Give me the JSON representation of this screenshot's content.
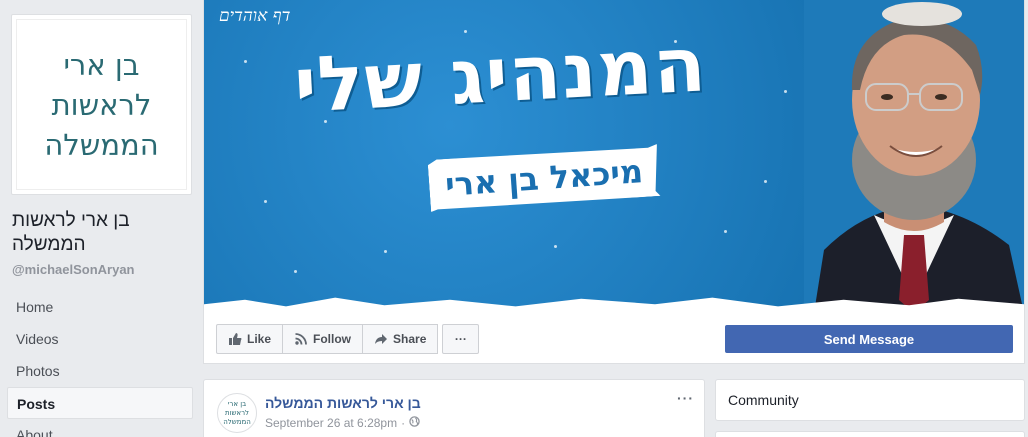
{
  "page": {
    "avatar_text_line1": "בן ארי",
    "avatar_text_line2": "לראשות",
    "avatar_text_line3": "הממשלה",
    "name": "בן ארי לראשות הממשלה",
    "handle": "@michaelSonAryan"
  },
  "sidebar": {
    "items": [
      {
        "label": "Home"
      },
      {
        "label": "Videos"
      },
      {
        "label": "Photos"
      },
      {
        "label": "Posts"
      },
      {
        "label": "About"
      }
    ],
    "active": "Posts"
  },
  "cover": {
    "signature": "דף אוהדים",
    "headline": "המנהיג שלי",
    "ribbon": "מיכאל בן ארי",
    "background_color": "#1e7ab9"
  },
  "actions": {
    "like_label": "Like",
    "follow_label": "Follow",
    "share_label": "Share",
    "more_label": "···",
    "send_message_label": "Send Message"
  },
  "post": {
    "author": "בן ארי לראשות הממשלה",
    "timestamp": "September 26 at 6:28pm",
    "separator": "·",
    "audience_icon": "globe-icon",
    "menu_label": "···"
  },
  "community": {
    "title": "Community"
  },
  "colors": {
    "brand": "#4267b2",
    "link": "#365899",
    "page_bg": "#e9ebee"
  }
}
